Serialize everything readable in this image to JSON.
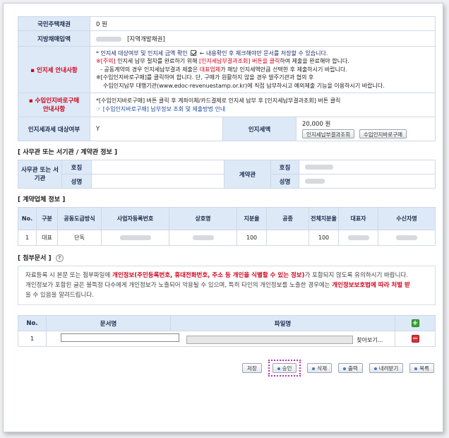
{
  "info": {
    "housing_bond_label": "국민주택채권",
    "housing_bond_value": "0 원",
    "local_bond_label": "지방채매입액",
    "local_bond_type": "[지역개발채권]",
    "stamp_guide_label": "인지세 안내사항",
    "stamp_guide_line1_a": "* 인지세 대상여부 및 인지세 금액 확인",
    "stamp_guide_line1_b": "← 내용확인 후 체크해야만 문서를 저장할 수 있습니다.",
    "stamp_guide_line2_a": "※[주의]",
    "stamp_guide_line2_b": " 인지세 납부 절차를 완료하기 위해 ",
    "stamp_guide_line2_c": "[인지세납부결과조회] 버튼을 클릭",
    "stamp_guide_line2_d": "하여 제출을 완료해야 합니다.",
    "stamp_guide_line3_a": "- 공동계약의 경우 인지세납부결과 제출은 ",
    "stamp_guide_line3_b": "대표업체",
    "stamp_guide_line3_c": "가 해당 인지세액만큼 선택한 후 제출하시기 바랍니다.",
    "stamp_guide_line4": "※[수입인지바로구매]를 클릭하여 합니다. 단, 구매가 원활하지 않을 경우 발주기관과 협의 후",
    "stamp_guide_line5": "수입인지납부 대행기관(www.edoc-revenuestamp.or.kr)에 직접 납부하시고 예외제출 기능을 이용하시기 바랍니다.",
    "direct_buy_label_1": "수입인지바로구매",
    "direct_buy_label_2": "안내사항",
    "direct_buy_line1": "*[수입인지바로구매] 버튼 클릭 후 계좌이체/카드결제로 인지세 납부 후 [인지세납부결과조회] 버튼 클릭",
    "direct_buy_line2_a": "☞ [수입인지바로구매]",
    "direct_buy_line2_b": " 납부정보 조회 및 제출방법 안내",
    "stamp_target_label": "인지세과세 대상여부",
    "stamp_target_value": "Y",
    "stamp_amount_label": "인지세액",
    "stamp_amount_value": "20,000 원",
    "btn_stamp_result": "인지세납부결과조회",
    "btn_stamp_buy": "수입인지바로구매"
  },
  "office": {
    "title": "[ 사무관 또는 서기관 / 계약관 정보 ]",
    "officer_label": "사무관 또는 서기관",
    "contract_label": "계약관",
    "rank_label": "호칭",
    "name_label": "성명"
  },
  "company": {
    "title": "[ 계약업체 정보 ]",
    "headers": [
      "No.",
      "구분",
      "공동도급방식",
      "사업자등록번호",
      "상호명",
      "지분율",
      "공종",
      "전체지분율",
      "대표자",
      "수신자명"
    ],
    "rows": [
      {
        "no": "1",
        "type": "대표",
        "method": "단독",
        "share": "100",
        "total_share": "100"
      }
    ]
  },
  "attach": {
    "title": "[ 첨부문서 ]",
    "notice_1a": "자료등록 시 본문 또는 첨부파일에 ",
    "notice_1b": "개인정보(주민등록번호, 휴대전화번호, 주소 등 개인을 식별할 수 있는 정보)",
    "notice_1c": "가 포함되지 않도록 유의하시기 바랍니다.",
    "notice_2a": "개인정보가 포함된 글은 불특정 다수에게 개인정보가 노출되어 악용될 수 있으며, 특히 타인의 개인정보를 노출한 경우에는 ",
    "notice_2b": "개인정보보호법에 따라 처벌 받",
    "notice_2c": "을 수 있음을 알려드립니다.",
    "headers": {
      "no": "No.",
      "doc_name": "문서명",
      "file_name": "파일명"
    },
    "rows": [
      {
        "no": "1",
        "browse": "찾아보기..."
      }
    ]
  },
  "actions": {
    "save": "저장",
    "approve": "승인",
    "delete": "삭제",
    "print": "출력",
    "download": "내려받기",
    "list": "목록"
  }
}
